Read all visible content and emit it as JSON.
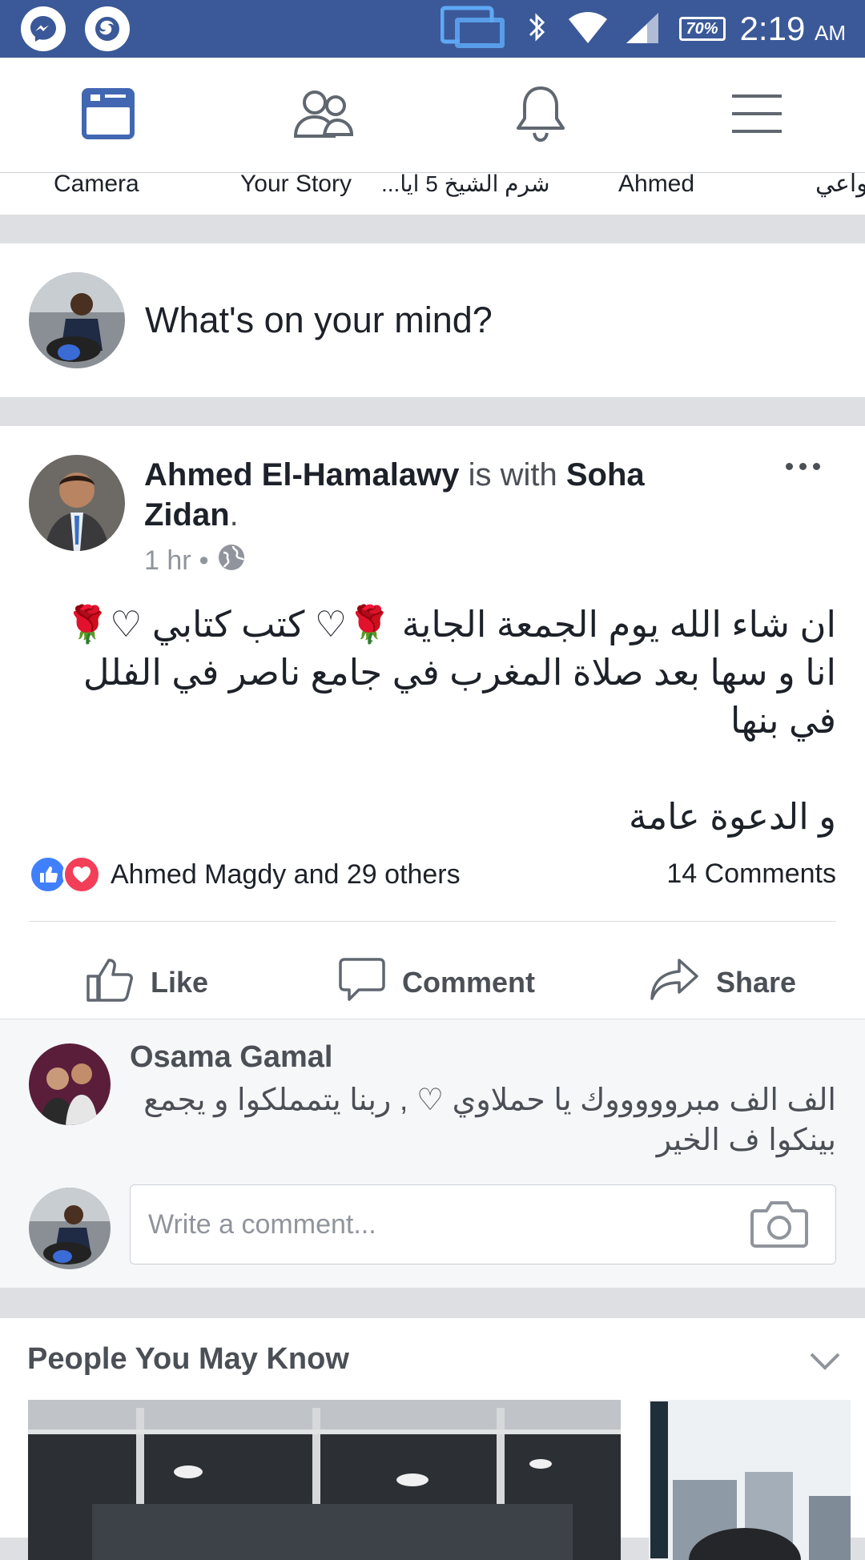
{
  "status_bar": {
    "battery": "70%",
    "time": "2:19",
    "ampm": "AM"
  },
  "nav": {
    "items": [
      {
        "icon": "news-feed-icon",
        "active": true
      },
      {
        "icon": "friends-icon",
        "active": false
      },
      {
        "icon": "notifications-icon",
        "active": false
      },
      {
        "icon": "menu-icon",
        "active": false
      }
    ]
  },
  "stories": {
    "labels": [
      "Camera",
      "Your Story",
      "شرم الشيخ 5 ايا...",
      "Ahmed",
      "واعي"
    ]
  },
  "composer": {
    "placeholder": "What's on your mind?"
  },
  "post": {
    "author": "Ahmed El-Hamalawy",
    "with_text": "is with",
    "tagged": "Soha Zidan",
    "tagged_suffix": ".",
    "time": "1 hr",
    "separator": "•",
    "body_line1": "ان شاء الله يوم الجمعة الجاية 🌹♡ كتب كتابي ♡🌹 انا و سها بعد صلاة المغرب في جامع ناصر في الفلل في بنها",
    "body_line2": "و الدعوة عامة",
    "reactions_text": "Ahmed Magdy and 29 others",
    "comments_count": "14 Comments",
    "actions": {
      "like": "Like",
      "comment": "Comment",
      "share": "Share"
    },
    "comment": {
      "name": "Osama Gamal",
      "text": "الف الف مبروووووك يا حملاوي ♡ , ربنا يتمملكوا و يجمع بينكوا ف الخير"
    },
    "write_comment_placeholder": "Write a comment..."
  },
  "pymk": {
    "title": "People You May Know"
  },
  "colors": {
    "brand": "#3b5998",
    "active_icon": "#4267b2",
    "like_blue": "#4080ff",
    "love_red": "#f33e58"
  }
}
